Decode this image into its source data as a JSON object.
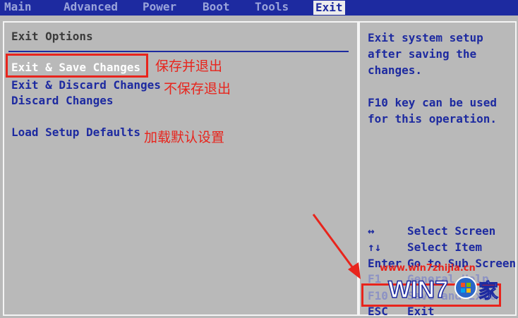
{
  "menu": {
    "tabs": [
      "Main",
      "Advanced",
      "Power",
      "Boot",
      "Tools",
      "Exit"
    ],
    "active": "Exit"
  },
  "main": {
    "title": "Exit Options",
    "options": [
      {
        "label": "Exit & Save Changes",
        "annotation": "保存并退出",
        "selected": true
      },
      {
        "label": "Exit & Discard Changes",
        "annotation": "不保存退出",
        "selected": false
      },
      {
        "label": "Discard Changes",
        "annotation": "",
        "selected": false
      },
      {
        "label": "Load Setup Defaults",
        "annotation": "加载默认设置",
        "selected": false
      }
    ]
  },
  "help": {
    "lines": [
      "Exit system setup",
      "after saving the",
      "changes.",
      "",
      "F10 key can be used",
      "for this operation."
    ],
    "keys": [
      {
        "key": "↔",
        "action": "Select Screen"
      },
      {
        "key": "↑↓",
        "action": "Select Item"
      },
      {
        "key": "Enter",
        "action": "Go to Sub Screen"
      },
      {
        "key": "F1",
        "action": "General Help"
      },
      {
        "key": "F10",
        "action": "Save and Exit"
      },
      {
        "key": "ESC",
        "action": "Exit"
      }
    ]
  },
  "watermark": {
    "url": "www.win7zhijia.cn",
    "logo_text": "WIN7",
    "logo_suffix": "家"
  },
  "colors": {
    "bios_blue": "#1d2aa0",
    "annotation_red": "#e8241c",
    "panel_gray": "#b9b9b9"
  }
}
